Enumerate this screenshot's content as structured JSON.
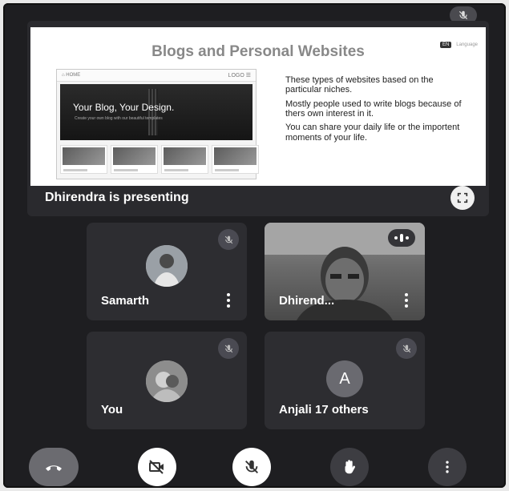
{
  "slide": {
    "title": "Blogs and Personal Websites",
    "corner_chip": "EN",
    "corner_text": "Language",
    "mock_nav_left": "⌂  HOME",
    "mock_nav_right": "LOGO ☰",
    "mock_hero_text": "Your Blog, Your Design.",
    "mock_hero_sub": "Create your own blog with our beautiful templates",
    "points": [
      "These types of websites based on the particular niches.",
      "Mostly people used to write blogs because of thers own interest in it.",
      "You can share your daily life or the importent moments of your life."
    ]
  },
  "presenting_label": "Dhirendra is presenting",
  "participants": [
    {
      "name": "Samarth",
      "muted": true
    },
    {
      "name": "Dhirend...",
      "speaking": true
    },
    {
      "name": "You",
      "muted": true
    },
    {
      "name": "Anjali 17 others",
      "initial": "A",
      "muted": true
    }
  ],
  "controls": {
    "end_call": "end-call",
    "camera": "camera-off",
    "mic": "mic-off",
    "raise_hand": "raise-hand",
    "more": "more-options"
  },
  "colors": {
    "background": "#1e1e21",
    "tile": "#2d2d31",
    "control_dark": "#3d3d42"
  }
}
